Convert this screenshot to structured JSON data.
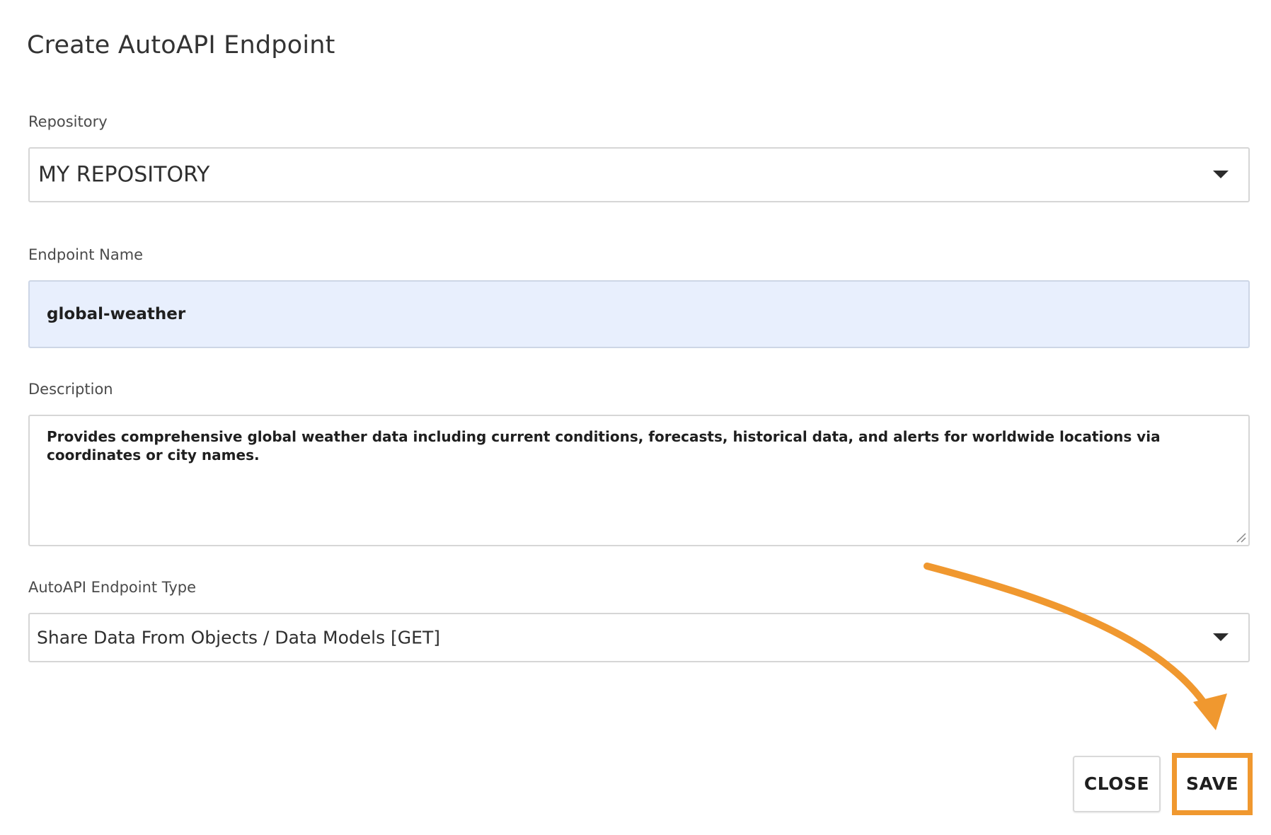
{
  "dialog": {
    "title": "Create AutoAPI Endpoint"
  },
  "repository": {
    "label": "Repository",
    "value": "MY REPOSITORY"
  },
  "endpoint_name": {
    "label": "Endpoint Name",
    "value": "global-weather"
  },
  "description": {
    "label": "Description",
    "value": "Provides comprehensive global weather data including current conditions, forecasts, historical data, and alerts for worldwide locations via coordinates or city names."
  },
  "endpoint_type": {
    "label": "AutoAPI Endpoint Type",
    "value": "Share Data From Objects / Data Models [GET]"
  },
  "footer": {
    "close_label": "CLOSE",
    "save_label": "SAVE"
  },
  "icons": {
    "dropdown": "chevron-down-icon",
    "annotation": "curved-arrow-icon"
  },
  "colors": {
    "highlight": "#f0982f",
    "input_fill": "#e8effd",
    "border": "#d6d6d6"
  }
}
